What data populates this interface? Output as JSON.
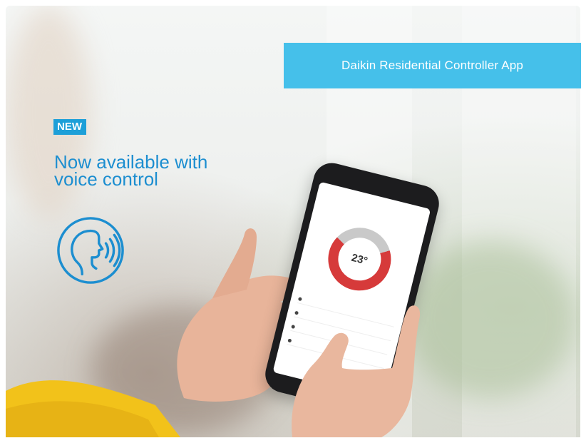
{
  "banner": {
    "label": "Daikin Residential Controller App"
  },
  "badge": {
    "label": "NEW"
  },
  "headline": {
    "line1": "Now available with",
    "line2": "voice control"
  },
  "icons": {
    "voice": "voice-control-icon"
  },
  "colors": {
    "banner": "#45c0ea",
    "badge": "#1d9fd8",
    "headline": "#1c8ed0"
  }
}
